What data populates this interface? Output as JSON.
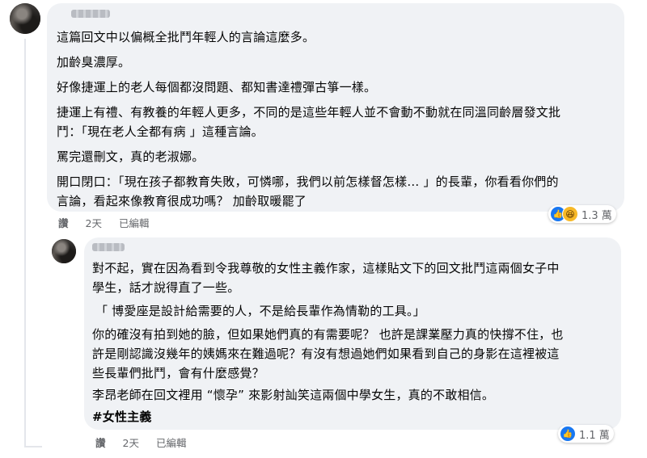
{
  "comment1": {
    "author_redacted": true,
    "paragraphs": [
      "這篇回文中以偏概全批鬥年輕人的言論這麼多。",
      "加齡臭濃厚。",
      "好像捷運上的老人每個都沒問題、都知書達禮彈古箏一樣。",
      "捷運上有禮、有教養的年輕人更多，不同的是這些年輕人並不會動不動就在同溫同齡層發文批",
      "鬥：「現在老人全都有病 」這種言論。",
      "罵完還刪文，真的老淑娜。",
      "開口閉口：「現在孩子都教育失敗，可憐哪，我們以前怎樣督怎樣… 」的長輩，你看看你們的",
      "言論，看起來像教育很成功嗎？ 加齡取暖罷了"
    ],
    "actions": {
      "like": "讚",
      "time": "2天",
      "edited": "已編輯"
    },
    "reactions": {
      "icons": [
        "like-icon",
        "haha-icon"
      ],
      "count": "1.3 萬"
    }
  },
  "comment2": {
    "author_redacted": true,
    "paragraphs": [
      "對不起，實在因為看到令我尊敬的女性主義作家，這樣貼文下的回文批鬥這兩個女子中",
      "學生，話才說得直了一些。",
      "「 博愛座是設計給需要的人，不是給長輩作為情勒的工具。」",
      "你的確沒有拍到她的臉，但如果她們真的有需要呢？ 也許是課業壓力真的快撐不住，也",
      "許是剛認識沒幾年的姨媽來在難過呢？有沒有想過她們如果看到自己的身影在這裡被這",
      "些長輩們批鬥，會有什麼感覺？",
      "李昂老師在回文裡用 “懷孕” 來影射訕笑這兩個中學女生，真的不敢相信。"
    ],
    "hashtag": "#女性主義",
    "actions": {
      "like": "讚",
      "time": "2天",
      "edited": "已編輯"
    },
    "reactions": {
      "icons": [
        "like-icon"
      ],
      "count": "1.1 萬"
    }
  }
}
